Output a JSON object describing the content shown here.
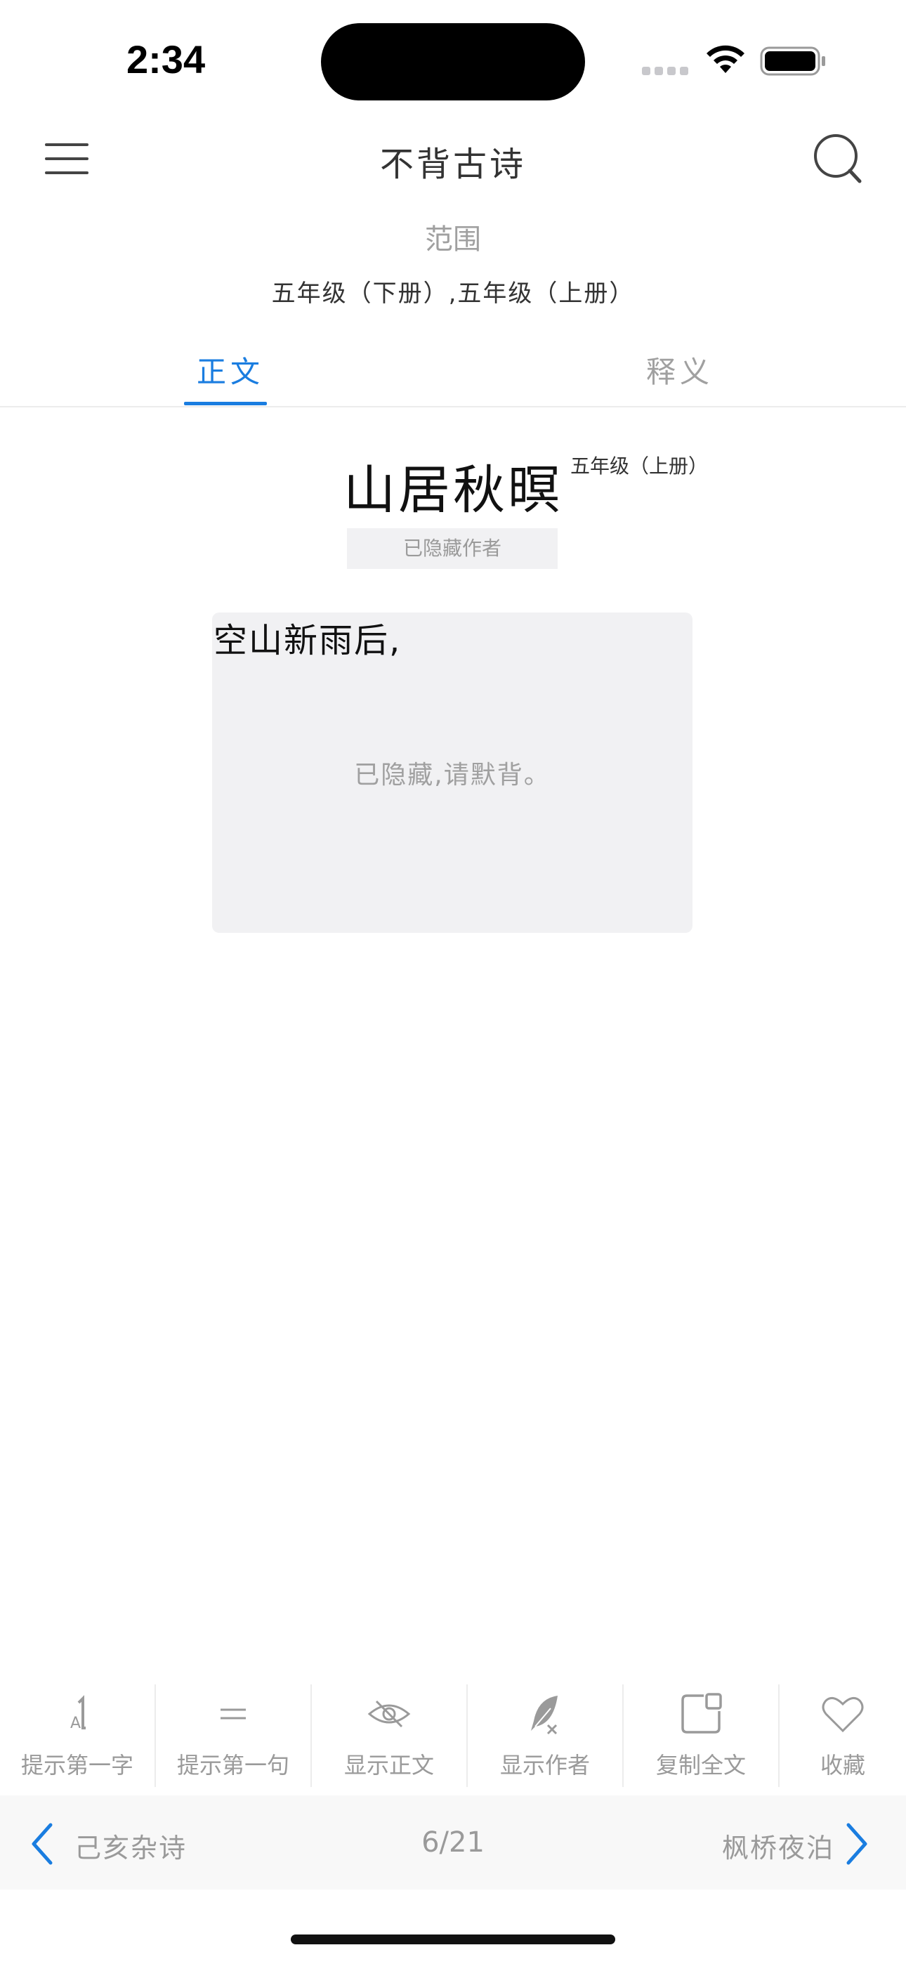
{
  "status_bar": {
    "time": "2:34"
  },
  "nav": {
    "title": "不背古诗"
  },
  "scope": {
    "label": "范围",
    "value": "五年级（下册）,五年级（上册）"
  },
  "tabs": [
    {
      "label": "正文",
      "active": true
    },
    {
      "label": "释义",
      "active": false
    }
  ],
  "poem": {
    "title": "山居秋暝",
    "grade": "五年级（上册）",
    "author_hidden": "已隐藏作者",
    "first_line": "空山新雨后,",
    "hidden_message": "已隐藏,请默背。"
  },
  "toolbar": {
    "items": [
      {
        "label": "提示第一字",
        "icon": "first-char-hint-icon"
      },
      {
        "label": "提示第一句",
        "icon": "first-line-hint-icon"
      },
      {
        "label": "显示正文",
        "icon": "eye-off-icon"
      },
      {
        "label": "显示作者",
        "icon": "feather-off-icon"
      },
      {
        "label": "复制全文",
        "icon": "copy-icon"
      },
      {
        "label": "收藏",
        "icon": "heart-icon"
      }
    ]
  },
  "pager": {
    "prev": "己亥杂诗",
    "position": "6/21",
    "next": "枫桥夜泊"
  },
  "colors": {
    "accent": "#1a7de0",
    "muted": "#9a9a9a",
    "placeholder_bg": "#f1f1f3"
  }
}
